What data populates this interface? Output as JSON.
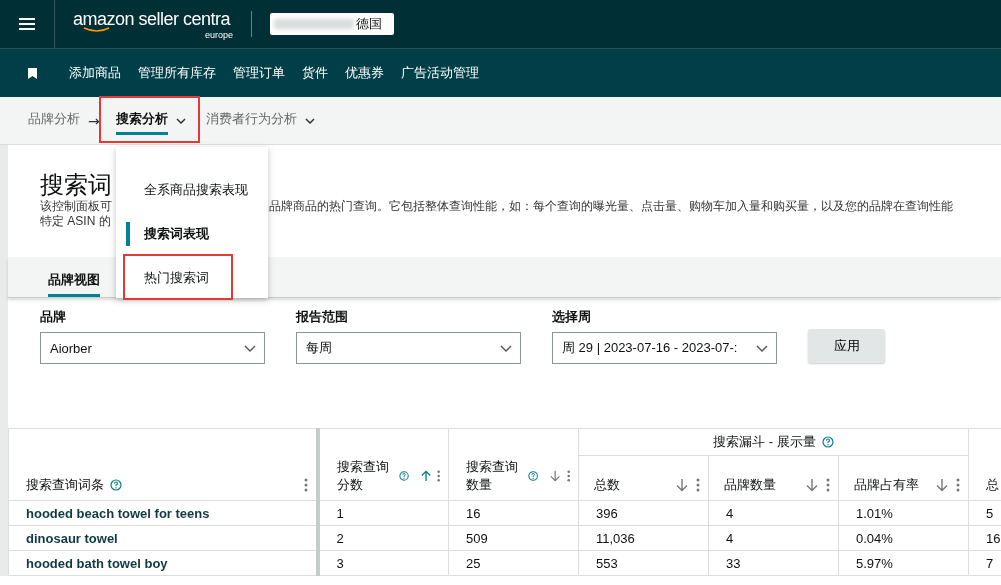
{
  "top_bar": {
    "logo": "amazon seller centra",
    "logo_sub": "europe",
    "account": "德国"
  },
  "nav": {
    "items": [
      "添加商品",
      "管理所有库存",
      "管理订单",
      "货件",
      "优惠券",
      "广告活动管理"
    ]
  },
  "breadcrumb": {
    "separator": "→",
    "items": [
      {
        "label": "品牌分析",
        "selected": false,
        "has_menu": false,
        "highlighted": false
      },
      {
        "label": "搜索分析",
        "selected": true,
        "has_menu": true,
        "highlighted": true
      },
      {
        "label": "消费者行为分析",
        "selected": false,
        "has_menu": true,
        "highlighted": false
      }
    ]
  },
  "menu": {
    "items": [
      {
        "label": "全系商品搜索表现",
        "selected": false,
        "highlighted": false
      },
      {
        "label": "搜索词表现",
        "selected": true,
        "highlighted": false
      },
      {
        "label": "热门搜索词",
        "selected": false,
        "highlighted": true
      }
    ]
  },
  "page": {
    "title": "搜索词",
    "description_parts": [
      "该控制面板可",
      "品牌商品的热门查询。它包括整体查询性能，如：每个查询的曝光量、点击量、购物车加入量和购买量，以及您的品牌在查询性能",
      "特定 ASIN 的"
    ]
  },
  "view_tabs": [
    {
      "label": "品牌视图",
      "selected": true
    }
  ],
  "filters": [
    {
      "label": "品牌",
      "value": "Aiorber"
    },
    {
      "label": "报告范围",
      "value": "每周"
    },
    {
      "label": "选择周",
      "value": "周 29 | 2023-07-16 - 2023-07-:"
    }
  ],
  "apply_button": "应用",
  "table": {
    "group_header": {
      "label": "搜索漏斗 - 展示量",
      "help": true
    },
    "columns": [
      {
        "label": "搜索查询词条",
        "help": true,
        "sortable": false,
        "sorted": false,
        "menu": true
      },
      {
        "label": "搜索查询分数",
        "help": true,
        "sortable": true,
        "sorted": true,
        "menu": true
      },
      {
        "label": "搜索查询数量",
        "help": true,
        "sortable": true,
        "sorted": false,
        "menu": true
      },
      {
        "label": "总数",
        "help": false,
        "sortable": true,
        "sorted": false,
        "menu": true
      },
      {
        "label": "品牌数量",
        "help": false,
        "sortable": true,
        "sorted": false,
        "menu": true
      },
      {
        "label": "品牌占有率",
        "help": false,
        "sortable": true,
        "sorted": false,
        "menu": true
      },
      {
        "label": "总",
        "help": false,
        "sortable": false,
        "sorted": false,
        "menu": false
      }
    ],
    "rows": [
      [
        "hooded beach towel for teens",
        "1",
        "16",
        "396",
        "4",
        "1.01%",
        "5"
      ],
      [
        "dinosaur towel",
        "2",
        "509",
        "11,036",
        "4",
        "0.04%",
        "16"
      ],
      [
        "hooded bath towel boy",
        "3",
        "25",
        "553",
        "33",
        "5.97%",
        "7"
      ]
    ]
  }
}
